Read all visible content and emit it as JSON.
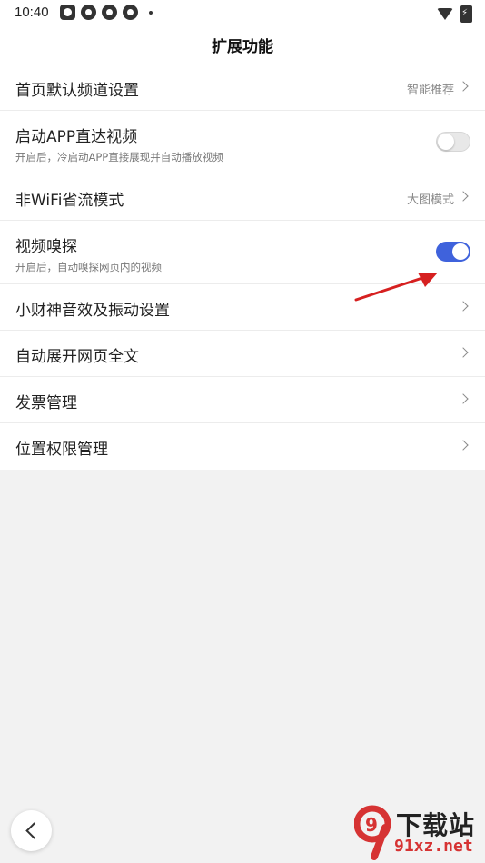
{
  "status_bar": {
    "time": "10:40",
    "notification_icons": [
      "paw-icon",
      "aperture-icon",
      "aperture-icon",
      "aperture-icon"
    ],
    "right_icons": [
      "wifi-icon",
      "battery-charging-icon"
    ]
  },
  "header": {
    "title": "扩展功能"
  },
  "settings": [
    {
      "label": "首页默认频道设置",
      "value": "智能推荐",
      "kind": "link"
    },
    {
      "label": "启动APP直达视频",
      "subtitle": "开启后，冷启动APP直接展现并自动播放视频",
      "kind": "toggle",
      "on": false
    },
    {
      "label": "非WiFi省流模式",
      "value": "大图模式",
      "kind": "link"
    },
    {
      "label": "视频嗅探",
      "subtitle": "开启后，自动嗅探网页内的视频",
      "kind": "toggle",
      "on": true
    },
    {
      "label": "小财神音效及振动设置",
      "kind": "link"
    },
    {
      "label": "自动展开网页全文",
      "kind": "link"
    },
    {
      "label": "发票管理",
      "kind": "link"
    },
    {
      "label": "位置权限管理",
      "kind": "link"
    }
  ],
  "watermark": {
    "title": "下载站",
    "url": "91xz.net",
    "logo_text": "9"
  },
  "colors": {
    "accent": "#3f62dc",
    "annotation_arrow": "#d62020",
    "watermark_red": "#d63333"
  }
}
